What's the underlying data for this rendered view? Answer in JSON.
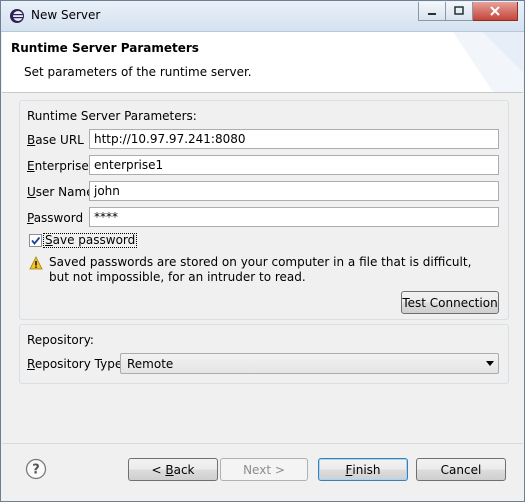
{
  "window": {
    "title": "New Server"
  },
  "header": {
    "title": "Runtime Server Parameters",
    "description": "Set parameters of the runtime server."
  },
  "params_group": {
    "title": "Runtime Server Parameters:",
    "base_url": {
      "label_u": "B",
      "label_rest": "ase URL",
      "value": "http://10.97.97.241:8080"
    },
    "enterprise": {
      "label_u": "E",
      "label_rest": "nterprise",
      "value": "enterprise1"
    },
    "user_name": {
      "label_u": "U",
      "label_rest": "ser Name",
      "value": "john"
    },
    "password": {
      "label_u": "P",
      "label_rest": "assword",
      "value": "****"
    },
    "save_password": {
      "label_u": "S",
      "label_rest": "ave password",
      "checked": true
    },
    "warning": "Saved passwords are stored on your computer in a file that is difficult, but not impossible, for an intruder to read.",
    "test_connection": "Test Connection"
  },
  "repository_group": {
    "title": "Repository:",
    "type_label_u": "R",
    "type_label_rest": "epository Type:",
    "type_value": "Remote"
  },
  "footer": {
    "back_prefix": "< ",
    "back_u": "B",
    "back_rest": "ack",
    "next": "Next >",
    "finish_u": "F",
    "finish_rest": "inish",
    "cancel": "Cancel"
  },
  "icons": {
    "app": "eclipse-icon",
    "warning": "warning-icon",
    "help": "help-icon"
  },
  "colors": {
    "accent": "#3c7fb1",
    "warning": "#e8b923"
  }
}
